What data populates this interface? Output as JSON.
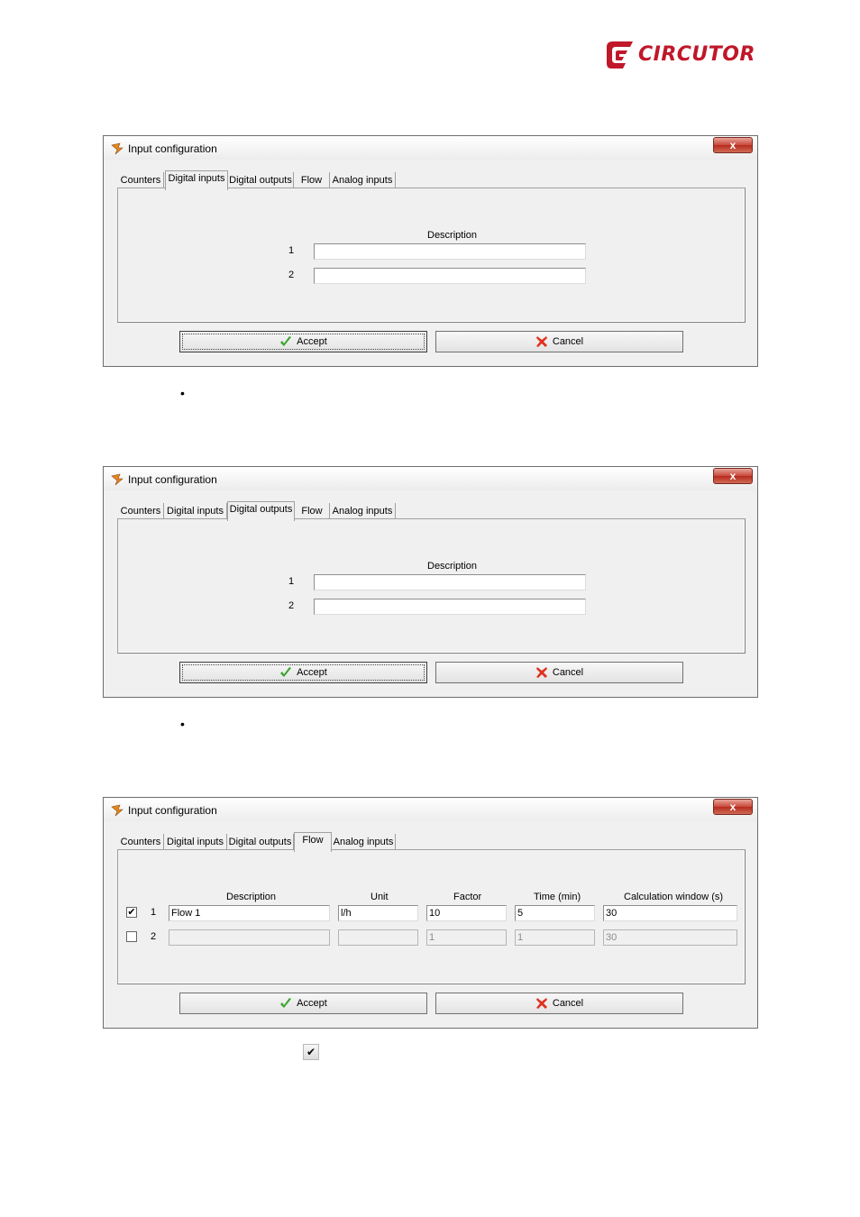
{
  "logo": {
    "text": "CIRCUTOR",
    "color": "#c0172a"
  },
  "bullet_glyph": "•",
  "checkmark_glyph": "✔",
  "dialogs": [
    {
      "title": "Input configuration",
      "close_label": "x",
      "tabs": [
        "Counters",
        "Digital inputs",
        "Digital outputs",
        "Flow",
        "Analog inputs"
      ],
      "active_tab": "Digital inputs",
      "column_header": "Description",
      "rows": [
        {
          "index": "1",
          "value": ""
        },
        {
          "index": "2",
          "value": ""
        }
      ],
      "accept_label": "Accept",
      "cancel_label": "Cancel"
    },
    {
      "title": "Input configuration",
      "close_label": "x",
      "tabs": [
        "Counters",
        "Digital inputs",
        "Digital outputs",
        "Flow",
        "Analog inputs"
      ],
      "active_tab": "Digital outputs",
      "column_header": "Description",
      "rows": [
        {
          "index": "1",
          "value": ""
        },
        {
          "index": "2",
          "value": ""
        }
      ],
      "accept_label": "Accept",
      "cancel_label": "Cancel"
    },
    {
      "title": "Input configuration",
      "close_label": "x",
      "tabs": [
        "Counters",
        "Digital inputs",
        "Digital outputs",
        "Flow",
        "Analog inputs"
      ],
      "active_tab": "Flow",
      "headers": {
        "description": "Description",
        "unit": "Unit",
        "factor": "Factor",
        "time": "Time (min)",
        "window": "Calculation window (s)"
      },
      "rows": [
        {
          "checked": true,
          "index": "1",
          "description": "Flow 1",
          "unit": "l/h",
          "factor": "10",
          "time": "5",
          "window": "30"
        },
        {
          "checked": false,
          "index": "2",
          "description": "",
          "unit": "",
          "factor": "1",
          "time": "1",
          "window": "30"
        }
      ],
      "accept_label": "Accept",
      "cancel_label": "Cancel"
    }
  ]
}
